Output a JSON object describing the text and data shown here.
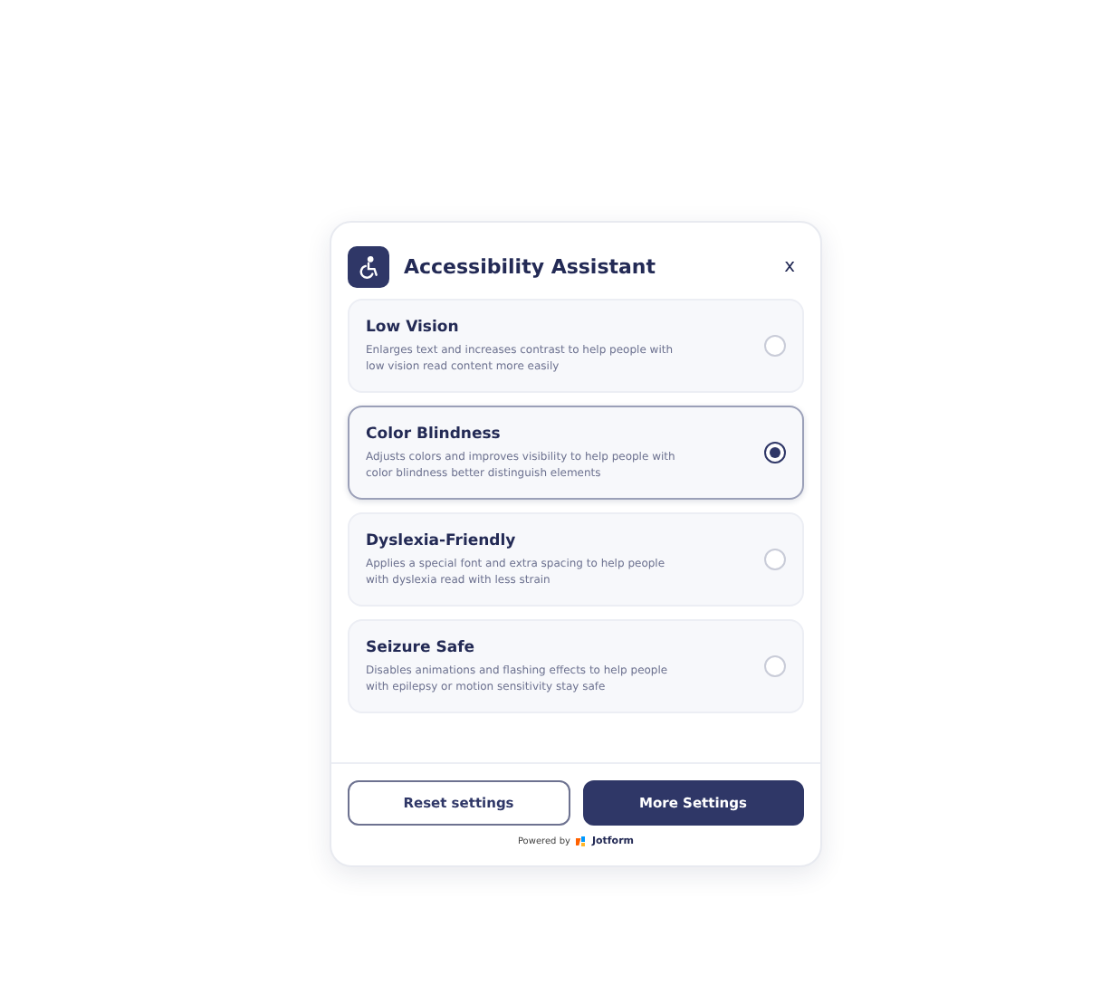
{
  "header": {
    "title": "Accessibility Assistant",
    "close": "x"
  },
  "options": [
    {
      "title": "Low Vision",
      "description": "Enlarges text and increases contrast to help people with low vision read content more easily",
      "selected": false
    },
    {
      "title": "Color Blindness",
      "description": "Adjusts colors and improves visibility to help people with color blindness better distinguish elements",
      "selected": true
    },
    {
      "title": "Dyslexia-Friendly",
      "description": "Applies a special font and extra spacing to help people with dyslexia read with less strain",
      "selected": false
    },
    {
      "title": "Seizure Safe",
      "description": "Disables animations and flashing effects to help people with epilepsy or motion sensitivity stay safe",
      "selected": false
    }
  ],
  "buttons": [
    {
      "label": "Reset settings",
      "kind": "secondary"
    },
    {
      "label": "More Settings",
      "kind": "primary"
    }
  ],
  "footer": {
    "powered_by": "Powered by",
    "brand": "Jotform"
  }
}
